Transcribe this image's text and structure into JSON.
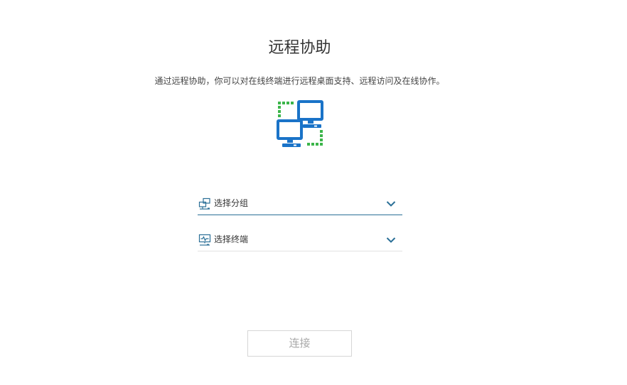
{
  "page": {
    "title": "远程协助",
    "description": "通过远程协助，你可以对在线终端进行远程桌面支持、远程访问及在线协作。"
  },
  "illustration": {
    "icon": "remote-computers-icon",
    "primary_color": "#1a73c8",
    "accent_color": "#3cb54a"
  },
  "group_select": {
    "icon": "group-computers-icon",
    "placeholder": "选择分组"
  },
  "terminal_select": {
    "icon": "monitor-icon",
    "placeholder": "选择终端"
  },
  "connect_button": {
    "label": "连接",
    "state": "disabled"
  },
  "colors": {
    "accent": "#2a6f97",
    "text": "#333333",
    "disabled_text": "#a8a8a8"
  }
}
